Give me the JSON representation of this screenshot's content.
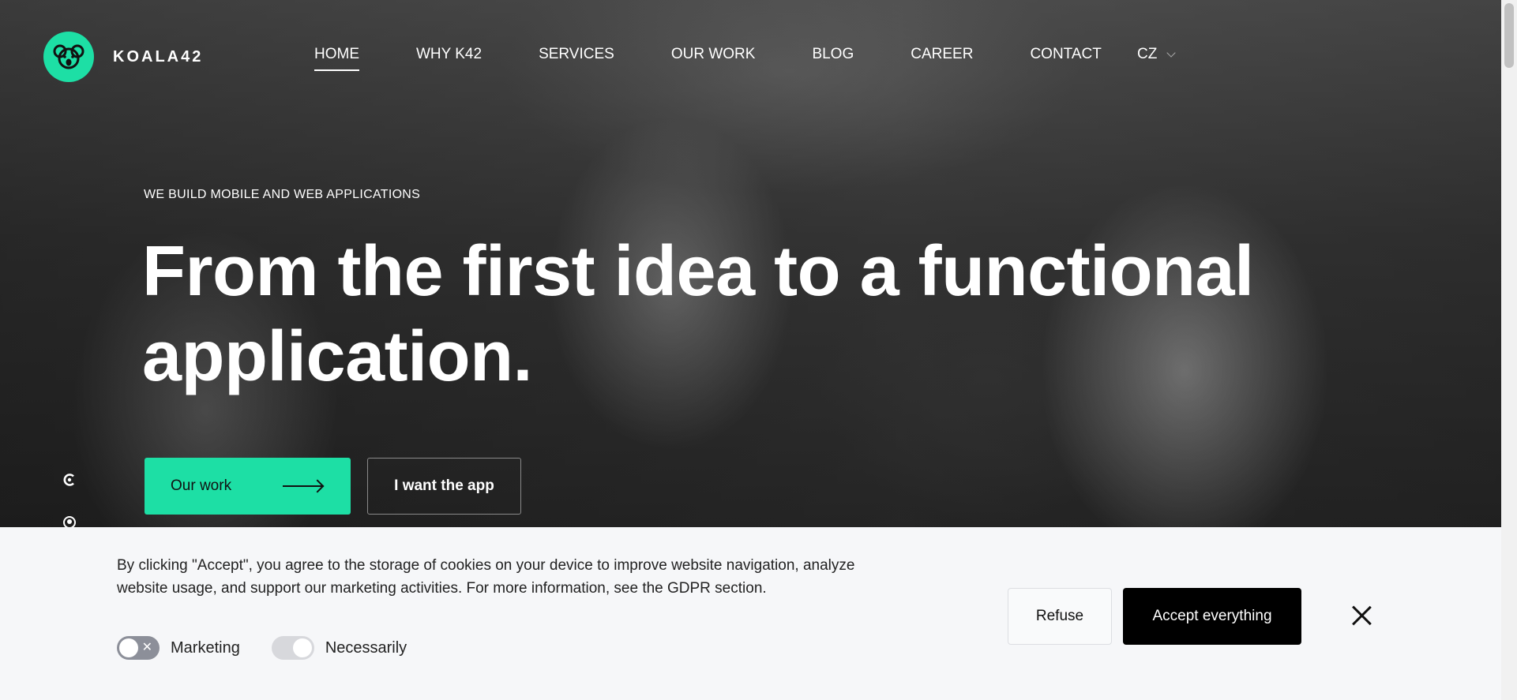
{
  "brand": {
    "name": "KOALA42",
    "logo_icon": "koala-icon",
    "accent": "#1ddfa5"
  },
  "nav": {
    "items": [
      {
        "label": "HOME"
      },
      {
        "label": "WHY K42"
      },
      {
        "label": "SERVICES"
      },
      {
        "label": "OUR WORK"
      },
      {
        "label": "BLOG"
      },
      {
        "label": "CAREER"
      },
      {
        "label": "CONTACT"
      }
    ],
    "active": "HOME",
    "language": "CZ"
  },
  "hero": {
    "tagline": "WE BUILD MOBILE AND WEB APPLICATIONS",
    "headline": "From the first idea to a functional application.",
    "primary_button": "Our work",
    "secondary_button": "I want the app"
  },
  "side_icons": [
    "clutch-icon",
    "github-icon"
  ],
  "cookie_banner": {
    "text": "By clicking \"Accept\", you agree to the storage of cookies on your device to improve website navigation, analyze website usage, and support our marketing activities. For more information, see the GDPR section.",
    "toggles": [
      {
        "label": "Marketing",
        "state": "off"
      },
      {
        "label": "Necessarily",
        "state": "on-disabled"
      }
    ],
    "refuse_label": "Refuse",
    "accept_label": "Accept everything"
  }
}
